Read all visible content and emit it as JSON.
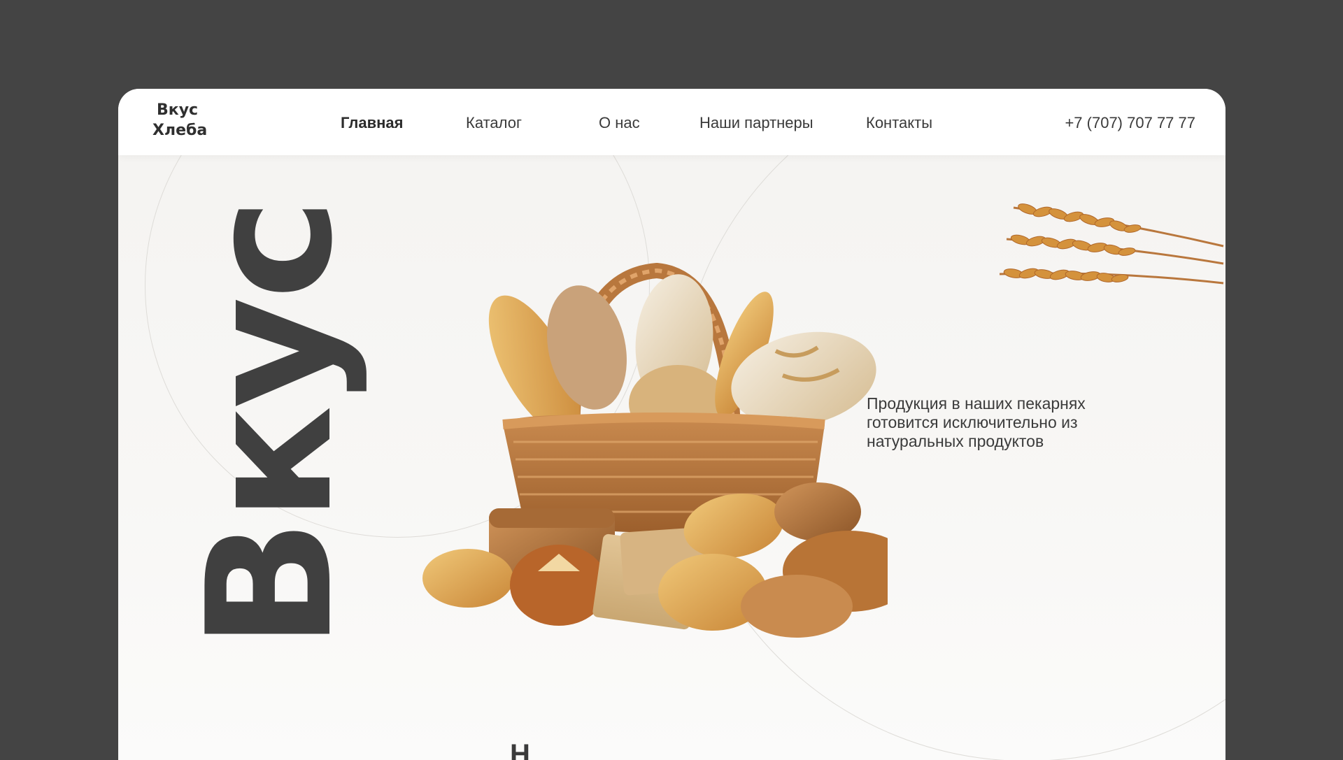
{
  "header": {
    "logo": {
      "line1": "Вкус",
      "line2": "Хлеба"
    },
    "nav": [
      {
        "label": "Главная",
        "active": true
      },
      {
        "label": "Каталог",
        "active": false
      },
      {
        "label": "О нас",
        "active": false
      },
      {
        "label": "Наши партнеры",
        "active": false
      },
      {
        "label": "Контакты",
        "active": false
      }
    ],
    "phone": "+7 (707) 707 77 77"
  },
  "hero": {
    "big_word": "Вкус",
    "tagline": "Продукция в наших пекарнях готовится исключительно из натуральных продуктов",
    "next_section_partial": "Н"
  },
  "colors": {
    "outer_background": "#444444",
    "text_dark": "#3a3a3a",
    "big_word": "#404040",
    "circle_stroke": "#dedcd8",
    "basket": "#b9773d",
    "wheat": "#d4923c"
  },
  "icons": [
    "wheat-illustration",
    "bread-basket-illustration"
  ]
}
